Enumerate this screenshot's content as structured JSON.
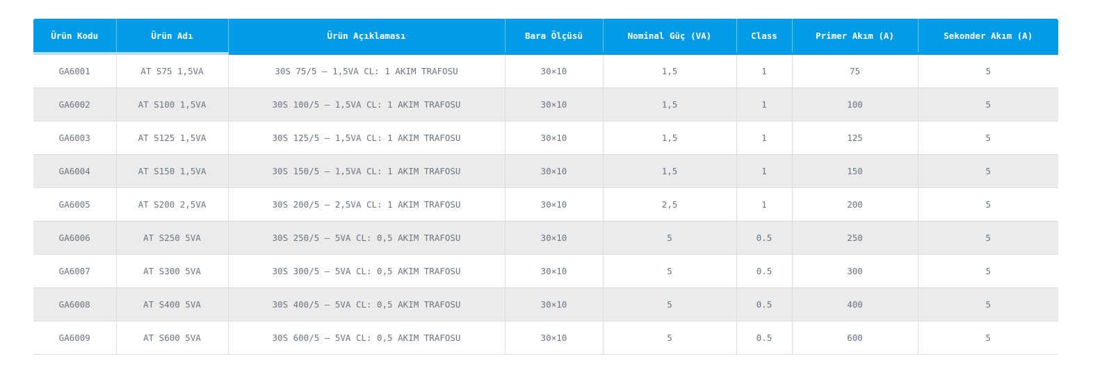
{
  "colors": {
    "header_bg": "#039be5",
    "header_text": "#ffffff",
    "row_alt_bg": "#ebebeb",
    "cell_text": "#6b7280"
  },
  "table": {
    "headers": [
      "Ürün Kodu",
      "Ürün Adı",
      "Ürün Açıklaması",
      "Bara Ölçüsü",
      "Nominal Güç (VA)",
      "Class",
      "Primer Akım (A)",
      "Sekonder Akım (A)"
    ],
    "rows": [
      [
        "GA6001",
        "AT S75 1,5VA",
        "30S 75/5 – 1,5VA CL: 1 AKIM TRAFOSU",
        "30×10",
        "1,5",
        "1",
        "75",
        "5"
      ],
      [
        "GA6002",
        "AT S100 1,5VA",
        "30S 100/5 – 1,5VA CL: 1 AKIM TRAFOSU",
        "30×10",
        "1,5",
        "1",
        "100",
        "5"
      ],
      [
        "GA6003",
        "AT S125 1,5VA",
        "30S 125/5 – 1,5VA CL: 1 AKIM TRAFOSU",
        "30×10",
        "1,5",
        "1",
        "125",
        "5"
      ],
      [
        "GA6004",
        "AT S150 1,5VA",
        "30S 150/5 – 1,5VA CL: 1 AKIM TRAFOSU",
        "30×10",
        "1,5",
        "1",
        "150",
        "5"
      ],
      [
        "GA6005",
        "AT S200 2,5VA",
        "30S 200/5 – 2,5VA CL: 1 AKIM TRAFOSU",
        "30×10",
        "2,5",
        "1",
        "200",
        "5"
      ],
      [
        "GA6006",
        "AT S250 5VA",
        "30S 250/5 – 5VA CL: 0,5 AKIM TRAFOSU",
        "30×10",
        "5",
        "0.5",
        "250",
        "5"
      ],
      [
        "GA6007",
        "AT S300 5VA",
        "30S 300/5 – 5VA CL: 0,5 AKIM TRAFOSU",
        "30×10",
        "5",
        "0.5",
        "300",
        "5"
      ],
      [
        "GA6008",
        "AT S400 5VA",
        "30S 400/5 – 5VA CL: 0,5 AKIM TRAFOSU",
        "30×10",
        "5",
        "0.5",
        "400",
        "5"
      ],
      [
        "GA6009",
        "AT S600 5VA",
        "30S 600/5 – 5VA CL: 0,5 AKIM TRAFOSU",
        "30×10",
        "5",
        "0.5",
        "600",
        "5"
      ]
    ]
  }
}
